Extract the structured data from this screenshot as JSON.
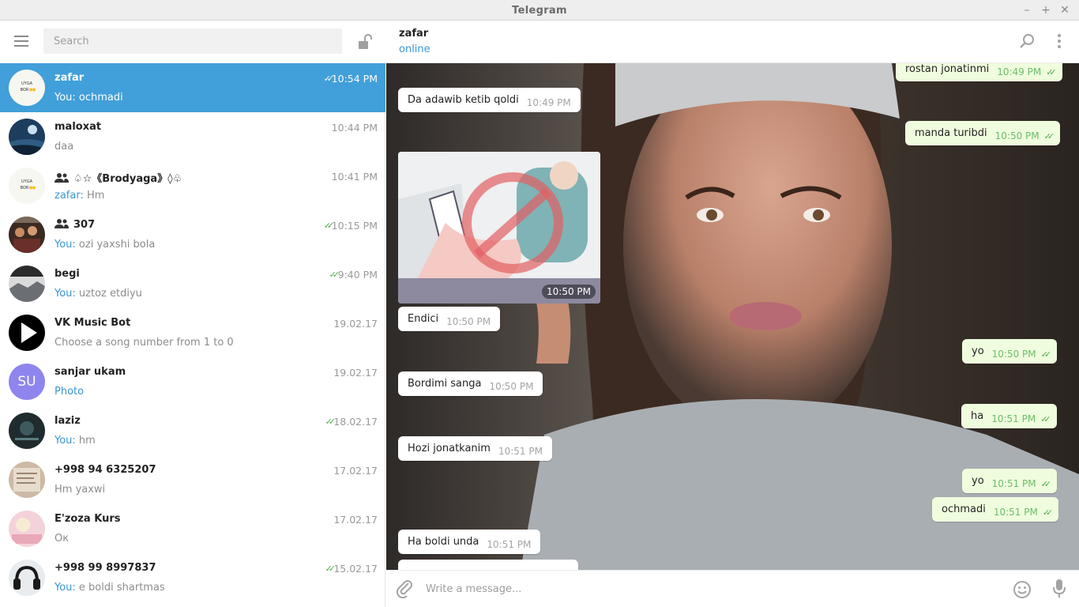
{
  "window": {
    "title": "Telegram",
    "controls": {
      "minimize": "–",
      "maximize": "+",
      "close": "✕"
    }
  },
  "sidebar": {
    "search_placeholder": "Search",
    "menu_icon": "hamburger-menu-icon",
    "lock_icon": "unlock-icon",
    "chats": [
      {
        "name": "zafar",
        "time": "10:54 PM",
        "you": "You: ",
        "preview": "ochmadi",
        "ticks": "✓✓",
        "active": true,
        "avatar": "uyga-bor-avatar"
      },
      {
        "name": "maloxat",
        "time": "10:44 PM",
        "you": "",
        "preview": "daa",
        "ticks": "",
        "avatar": "night-sky-avatar"
      },
      {
        "name": "♤☆《Brodyaga》◊♧",
        "time": "10:41 PM",
        "you": "zafar: ",
        "preview": "Hm",
        "ticks": "",
        "group": true,
        "avatar": "uyga-bor-avatar"
      },
      {
        "name": "307",
        "time": "10:15 PM",
        "you": "You: ",
        "preview": "ozi yaxshi bola",
        "ticks": "✓✓",
        "group": true,
        "avatar": "people-avatar"
      },
      {
        "name": "begi",
        "time": "9:40 PM",
        "you": "You: ",
        "preview": "uztoz etdiyu",
        "ticks": "✓✓",
        "avatar": "landscape-avatar"
      },
      {
        "name": "VK Music Bot",
        "time": "19.02.17",
        "you": "",
        "preview": "Choose a song number from 1 to 0",
        "ticks": "",
        "avatar": "play-icon-avatar"
      },
      {
        "name": "sanjar ukam",
        "time": "19.02.17",
        "you": "",
        "preview": "Photo",
        "ticks": "",
        "initials": "SU",
        "avatar": "initials-avatar"
      },
      {
        "name": "laziz",
        "time": "18.02.17",
        "you": "You: ",
        "preview": "hm",
        "ticks": "✓✓",
        "avatar": "dark-avatar"
      },
      {
        "name": "+998 94 6325207",
        "time": "17.02.17",
        "you": "",
        "preview": "Hm yaxwi",
        "ticks": "",
        "avatar": "paper-avatar"
      },
      {
        "name": "E'zoza Kurs",
        "time": "17.02.17",
        "you": "",
        "preview": "Ок",
        "ticks": "",
        "avatar": "pink-avatar"
      },
      {
        "name": "+998 99 8997837",
        "time": "15.02.17",
        "you": "You: ",
        "preview": "e boldi shartmas",
        "ticks": "✓✓",
        "avatar": "headphones-avatar"
      }
    ]
  },
  "chat": {
    "peer_name": "zafar",
    "peer_status": "online",
    "messages": [
      {
        "dir": "out",
        "text": "rostan jonatinmi",
        "time": "10:49 PM",
        "ticks": "✓✓"
      },
      {
        "dir": "in",
        "text": "Da adawib ketib qoldi",
        "time": "10:49 PM"
      },
      {
        "dir": "out",
        "text": "manda turibdi",
        "time": "10:50 PM",
        "ticks": "✓✓"
      },
      {
        "dir": "in",
        "photo": true,
        "time": "10:50 PM"
      },
      {
        "dir": "in",
        "text": "Endici",
        "time": "10:50 PM"
      },
      {
        "dir": "out",
        "text": "yo",
        "time": "10:50 PM",
        "ticks": "✓✓"
      },
      {
        "dir": "in",
        "text": "Bordimi sanga",
        "time": "10:50 PM"
      },
      {
        "dir": "out",
        "text": "ha",
        "time": "10:51 PM",
        "ticks": "✓✓"
      },
      {
        "dir": "in",
        "text": "Hozi jonatkanim",
        "time": "10:51 PM"
      },
      {
        "dir": "out",
        "text": "yo",
        "time": "10:51 PM",
        "ticks": "✓✓"
      },
      {
        "dir": "out",
        "text": "ochmadi",
        "time": "10:51 PM",
        "ticks": "✓✓"
      },
      {
        "dir": "in",
        "text": "Ha boldi unda",
        "time": "10:51 PM"
      }
    ],
    "composer_placeholder": "Write a message..."
  },
  "colors": {
    "accent": "#419fd9",
    "link": "#3a97d4",
    "tick": "#4fae4e",
    "out_bubble": "#effdde"
  }
}
